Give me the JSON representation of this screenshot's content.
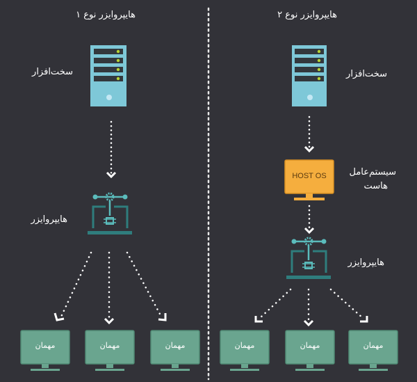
{
  "left": {
    "title": "هایپروایزر نوع ۱",
    "hardware_label": "سخت‌افزار",
    "hypervisor_label": "هایپروایزر",
    "guests": [
      "مهمان",
      "مهمان",
      "مهمان"
    ]
  },
  "right": {
    "title": "هایپروایزر نوع ۲",
    "hardware_label": "سخت‌افزار",
    "host_os_label_line1": "سیستم‌عامل",
    "host_os_label_line2": "هاست",
    "host_os_screen": "HOST OS",
    "hypervisor_label": "هایپروایزر",
    "guests": [
      "مهمان",
      "مهمان",
      "مهمان"
    ]
  },
  "colors": {
    "background": "#323238",
    "server": "#7ec8d8",
    "server_led": "#b5d334",
    "hypervisor": "#3aa3a3",
    "host_os": "#f5ae3e",
    "guest": "#6aa58f",
    "arrows": "#ffffff"
  }
}
